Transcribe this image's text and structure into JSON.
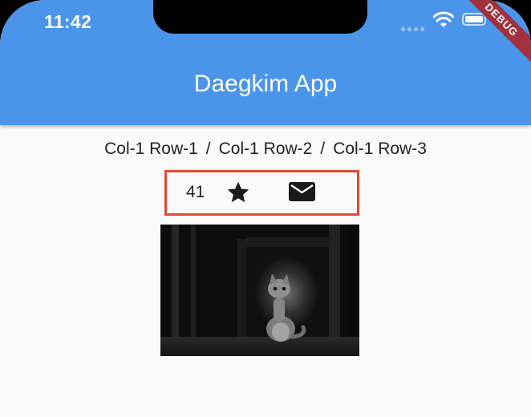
{
  "status_bar": {
    "time": "11:42",
    "debug_banner": "DEBUG"
  },
  "app_bar": {
    "title": "Daegkim App"
  },
  "row_labels": [
    "Col-1 Row-1",
    "Col-1 Row-2",
    "Col-1 Row-3"
  ],
  "row_separator": "/",
  "stats": {
    "count": "41",
    "icons": [
      "star-icon",
      "mail-icon"
    ]
  },
  "image": {
    "subject": "kitten-photo",
    "style": "black-and-white"
  },
  "colors": {
    "app_bar": "#4a95ea",
    "highlight_border": "#e04a35",
    "debug_banner": "#a2303d"
  }
}
